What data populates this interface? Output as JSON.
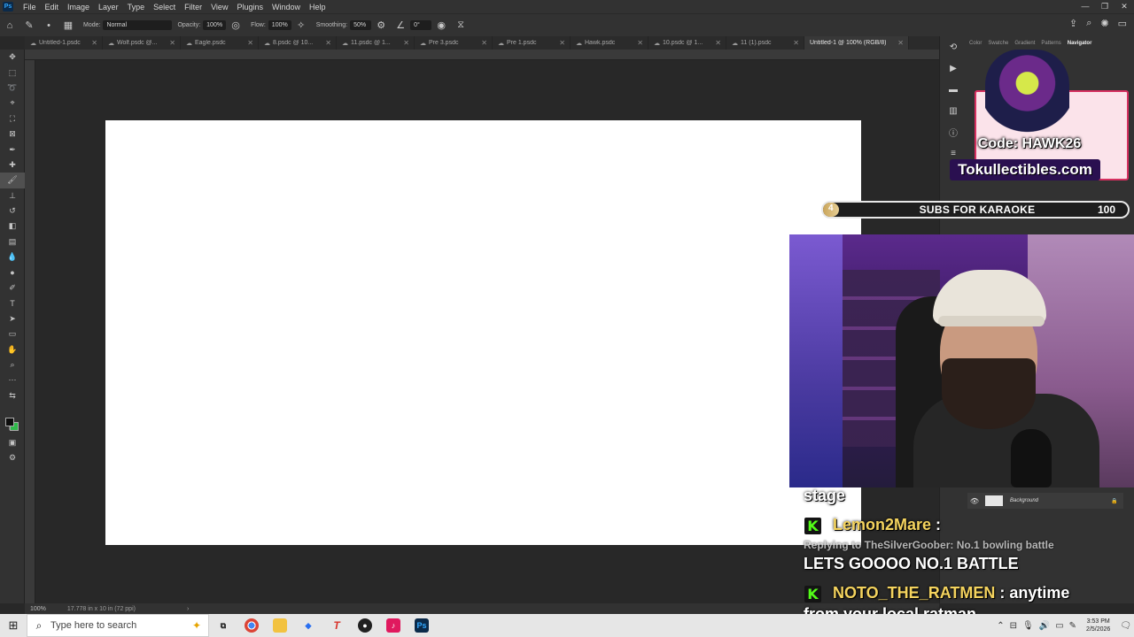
{
  "app": {
    "logo": "Ps",
    "menu": [
      "File",
      "Edit",
      "Image",
      "Layer",
      "Type",
      "Select",
      "Filter",
      "View",
      "Plugins",
      "Window",
      "Help"
    ]
  },
  "options": {
    "mode_label": "Mode:",
    "mode_value": "Normal",
    "opacity_label": "Opacity:",
    "opacity_value": "100%",
    "flow_label": "Flow:",
    "flow_value": "100%",
    "smoothing_label": "Smoothing:",
    "smoothing_value": "50%",
    "angle_value": "0°"
  },
  "tabs": [
    {
      "name": "Untitled-1.psdc",
      "active": false
    },
    {
      "name": "Wolf.psdc @...",
      "active": false
    },
    {
      "name": "Eagle.psdc",
      "active": false
    },
    {
      "name": "8.psdc @ 10...",
      "active": false
    },
    {
      "name": "11.psdc @ 1...",
      "active": false
    },
    {
      "name": "Pre 3.psdc",
      "active": false
    },
    {
      "name": "Pre 1.psdc",
      "active": false
    },
    {
      "name": "Hawk.psdc",
      "active": false
    },
    {
      "name": "10.psdc @ 1...",
      "active": false
    },
    {
      "name": "11 (1).psdc",
      "active": false
    },
    {
      "name": "Untitled-1 @ 100% (RGB/8)",
      "active": true
    }
  ],
  "status": {
    "zoom": "100%",
    "doc_info": "17.778 in x 10 in (72 ppi)"
  },
  "panel": {
    "tabs": [
      "Color",
      "Swatche",
      "Gradient",
      "Patterns",
      "Navigator"
    ],
    "active_tab": "Navigator",
    "layer_name": "Background"
  },
  "overlay": {
    "sponsor_code": "Code: HAWK26",
    "sponsor_site": "Tokullectibles.com",
    "goal": {
      "current": "4",
      "title": "SUBS FOR KARAOKE",
      "target": "100",
      "progress_fraction": 0.04
    },
    "chat": {
      "line0": "stage",
      "msg1_user": "Lemon2Mare",
      "msg1_reply": "Replying to TheSilverGoober: No.1 bowling battle",
      "msg1_text": "LETS GOOOO NO.1 BATTLE",
      "msg2_user": "NOTO_THE_RATMEN",
      "msg2_text_a": "anytime",
      "msg2_text_b": "from your local ratman",
      "badge": "K"
    }
  },
  "taskbar": {
    "search_placeholder": "Type here to search",
    "time": "3:53 PM",
    "date": "2/5/2026"
  },
  "colors": {
    "foreground": "#0d0d0d",
    "background": "#2fb84a",
    "kick_green": "#53fc18"
  }
}
